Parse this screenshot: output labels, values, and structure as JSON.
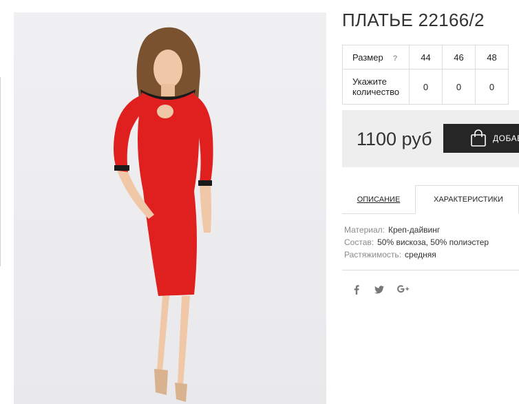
{
  "product": {
    "title": "ПЛАТЬЕ 22166/2",
    "image_alt": "Красное платье"
  },
  "sizes": {
    "size_label": "Размер",
    "help_label": "?",
    "qty_label": "Укажите количество",
    "columns": [
      {
        "size": "44",
        "qty": "0"
      },
      {
        "size": "46",
        "qty": "0"
      },
      {
        "size": "48",
        "qty": "0"
      }
    ]
  },
  "purchase": {
    "price": "1100 руб",
    "cart_button": "ДОБАВ"
  },
  "tabs": [
    {
      "label": "ОПИСАНИЕ",
      "active": false
    },
    {
      "label": "ХАРАКТЕРИСТИКИ",
      "active": true
    }
  ],
  "specs": [
    {
      "key": "Материал:",
      "value": "Креп-дайвинг"
    },
    {
      "key": "Состав:",
      "value": "50% вискоза, 50% полиэстер"
    },
    {
      "key": "Растяжимость:",
      "value": "средняя"
    }
  ],
  "social": [
    {
      "icon": "facebook-icon",
      "glyph": "f"
    },
    {
      "icon": "twitter-icon",
      "glyph": "t"
    },
    {
      "icon": "googleplus-icon",
      "glyph": "g+"
    }
  ],
  "colors": {
    "dress": "#e0201e",
    "price_box": "#eeeeee",
    "button": "#262626",
    "border": "#dcdcdc"
  }
}
